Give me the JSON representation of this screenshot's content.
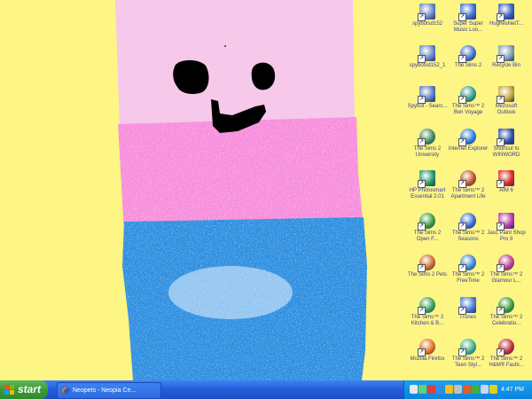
{
  "desktop": {
    "background": "#fdf584",
    "icons": [
      {
        "label": "spybotsd152",
        "icon": "installer-icon",
        "color": "#6a86c8"
      },
      {
        "label": "Super Super Music Loo...",
        "icon": "music-note-icon",
        "color": "#3d6fd8"
      },
      {
        "label": "HughesNetT...",
        "icon": "network-icon",
        "color": "#3a5fbf"
      },
      {
        "label": "spybotsd152_1",
        "icon": "installer-icon",
        "color": "#6a86c8"
      },
      {
        "label": "The Sims 2",
        "icon": "sims-icon",
        "color": "#3b6ec8"
      },
      {
        "label": "Recycle Bin",
        "icon": "recycle-bin-icon",
        "color": "#7fa0b8"
      },
      {
        "label": "Spybot - Searc...",
        "icon": "spybot-icon",
        "color": "#5b7bc0"
      },
      {
        "label": "The Sims™ 2 Bon Voyage",
        "icon": "sims-icon",
        "color": "#2f9a8a"
      },
      {
        "label": "Microsoft Outlook",
        "icon": "outlook-icon",
        "color": "#c8a640"
      },
      {
        "label": "The Sims 2 University",
        "icon": "sims-icon",
        "color": "#3d8a5c"
      },
      {
        "label": "Internet Explorer",
        "icon": "internet-explorer-icon",
        "color": "#2a7be0"
      },
      {
        "label": "Shortcut to WINWORD",
        "icon": "word-icon",
        "color": "#2a4fae"
      },
      {
        "label": "HP Photosmart Essential 2.01",
        "icon": "photosmart-icon",
        "color": "#2a9a6a"
      },
      {
        "label": "The Sims™ 2 Apartment Life",
        "icon": "sims-icon",
        "color": "#c0502a"
      },
      {
        "label": "AIM 6",
        "icon": "aim-icon",
        "color": "#e0282a"
      },
      {
        "label": "The Sims 2 Open F...",
        "icon": "sims-icon",
        "color": "#3a9a3a"
      },
      {
        "label": "The Sims™ 2 Seasons",
        "icon": "sims-icon",
        "color": "#3a6ad0"
      },
      {
        "label": "Jasc Paint Shop Pro 9",
        "icon": "paint-shop-icon",
        "color": "#b83ab0"
      },
      {
        "label": "The Sims 2 Pets",
        "icon": "sims-icon",
        "color": "#c86a2a"
      },
      {
        "label": "The Sims™ 2 FreeTime",
        "icon": "sims-icon",
        "color": "#3a88d8"
      },
      {
        "label": "The Sims™ 2 Glamour L...",
        "icon": "sims-icon",
        "color": "#c03a90"
      },
      {
        "label": "The Sims™ 2 Kitchen & B...",
        "icon": "sims-icon",
        "color": "#3aa05a"
      },
      {
        "label": "iTunes",
        "icon": "itunes-icon",
        "color": "#4a7ad8"
      },
      {
        "label": "The Sims™ 2 Celebratio...",
        "icon": "sims-icon",
        "color": "#3a9a3a"
      },
      {
        "label": "Mozilla Firefox",
        "icon": "firefox-icon",
        "color": "#e07020"
      },
      {
        "label": "The Sims™ 2 Teen Styl...",
        "icon": "sims-icon",
        "color": "#3ab08a"
      },
      {
        "label": "The Sims™ 2 H&M® Fashi...",
        "icon": "sims-icon",
        "color": "#c02a3a"
      }
    ]
  },
  "taskbar": {
    "start_label": "start",
    "task_title": "Neopets - Neopia Ce...",
    "clock": "4:47 PM",
    "tray_icons": [
      "volume-icon",
      "network-tray-icon",
      "antivirus-tray-icon",
      "messenger-tray-icon",
      "update-tray-icon",
      "printer-tray-icon",
      "security-tray-icon",
      "sims-tray-icon",
      "shield-tray-icon",
      "aim-tray-icon"
    ]
  }
}
